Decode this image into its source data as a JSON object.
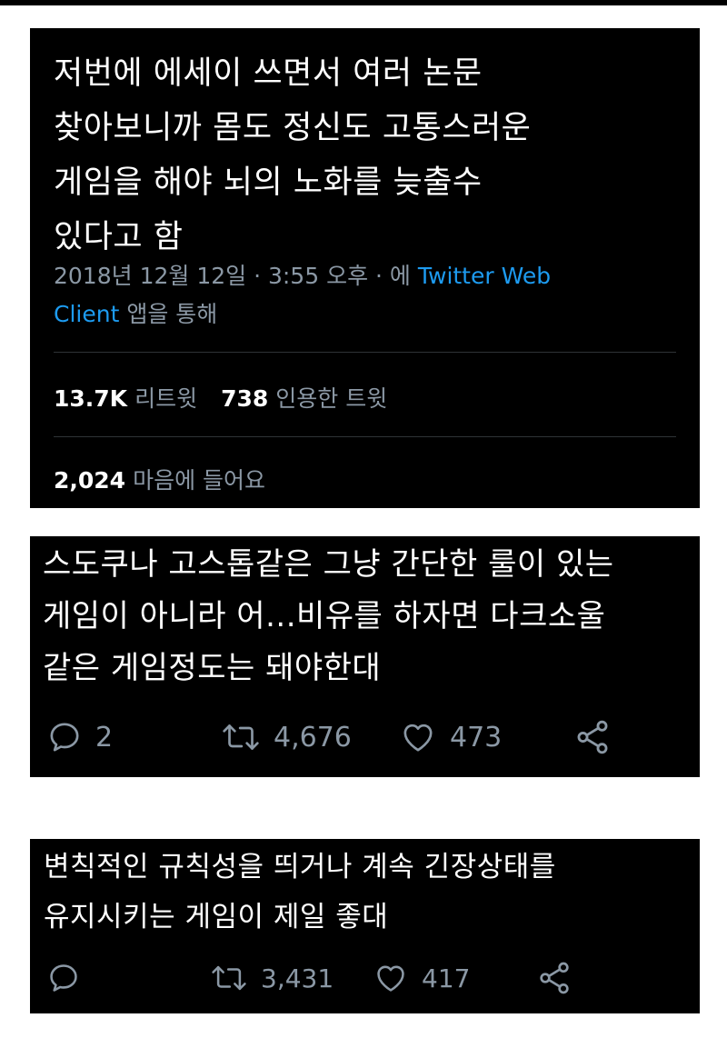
{
  "tweet": {
    "text": "저번에 에세이 쓰면서 여러 논문\n찾아보니까 몸도 정신도 고통스러운\n게임을 해야 뇌의 노화를 늦출수\n있다고 함",
    "date_time": "2018년 12월 12일 · 3:55 오후 · 에 ",
    "client_line1": "Twitter Web",
    "client_line2": "Client",
    "client_suffix": " 앱을 통해",
    "retweets_count": "13.7K",
    "retweets_label": "리트윗",
    "quotes_count": "738",
    "quotes_label": "인용한 트윗",
    "likes_count": "2,024",
    "likes_label": "마음에 들어요"
  },
  "reply1": {
    "text": "스도쿠나 고스톱같은 그냥 간단한 룰이 있는\n게임이 아니라 어...비유를 하자면 다크소울\n같은 게임정도는 돼야한대",
    "replies": "2",
    "retweets": "4,676",
    "likes": "473"
  },
  "reply2": {
    "text": "변칙적인 규칙성을 띄거나 계속 긴장상태를\n유지시키는 게임이 제일 좋대",
    "replies": "",
    "retweets": "3,431",
    "likes": "417"
  },
  "colors": {
    "background": "#000000",
    "text": "#ffffff",
    "muted": "#8b98a5",
    "link": "#1d9bf0"
  },
  "icons": [
    "reply-icon",
    "retweet-icon",
    "like-icon",
    "share-icon"
  ]
}
